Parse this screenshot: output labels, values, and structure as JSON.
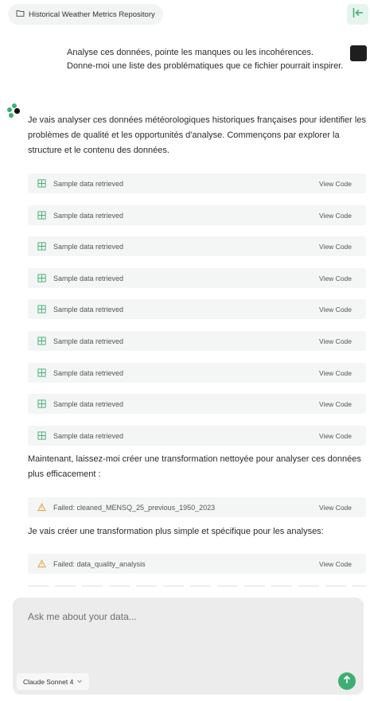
{
  "header": {
    "breadcrumb_label": "Historical Weather Metrics Repository",
    "folder_icon": "folder-icon",
    "collapse_icon": "sidebar-collapse-icon"
  },
  "user_message": {
    "lines": [
      "Analyse ces données, pointe les manques ou les incohérences.",
      "Donne-moi une liste des problématiques que ce fichier pourrait inspirer."
    ]
  },
  "assistant": {
    "intro": "Je vais analyser ces données météorologiques historiques françaises pour identifier les problèmes de qualité et les opportunités d'analyse. Commençons par explorer la structure et le contenu des données.",
    "tool_calls": [
      {
        "label": "Sample data retrieved",
        "action": "View Code",
        "status": "success"
      },
      {
        "label": "Sample data retrieved",
        "action": "View Code",
        "status": "success"
      },
      {
        "label": "Sample data retrieved",
        "action": "View Code",
        "status": "success"
      },
      {
        "label": "Sample data retrieved",
        "action": "View Code",
        "status": "success"
      },
      {
        "label": "Sample data retrieved",
        "action": "View Code",
        "status": "success"
      },
      {
        "label": "Sample data retrieved",
        "action": "View Code",
        "status": "success"
      },
      {
        "label": "Sample data retrieved",
        "action": "View Code",
        "status": "success"
      },
      {
        "label": "Sample data retrieved",
        "action": "View Code",
        "status": "success"
      },
      {
        "label": "Sample data retrieved",
        "action": "View Code",
        "status": "success"
      }
    ],
    "para2": "Maintenant, laissez-moi créer une transformation nettoyée pour analyser ces données plus efficacement :",
    "failed1": {
      "label": "Failed: cleaned_MENSQ_25_previous_1950_2023",
      "action": "View Code",
      "status": "failed"
    },
    "para3": "Je vais créer une transformation plus simple et spécifique pour les analyses:",
    "failed2": {
      "label": "Failed: data_quality_analysis",
      "action": "View Code",
      "status": "failed"
    }
  },
  "composer": {
    "placeholder": "Ask me about your data...",
    "model": "Claude Sonnet 4",
    "send_icon": "arrow-up-icon"
  },
  "colors": {
    "accent": "#3fae72",
    "warning": "#e0a13a",
    "panel": "#f4f5f5",
    "composer": "#ececec"
  }
}
